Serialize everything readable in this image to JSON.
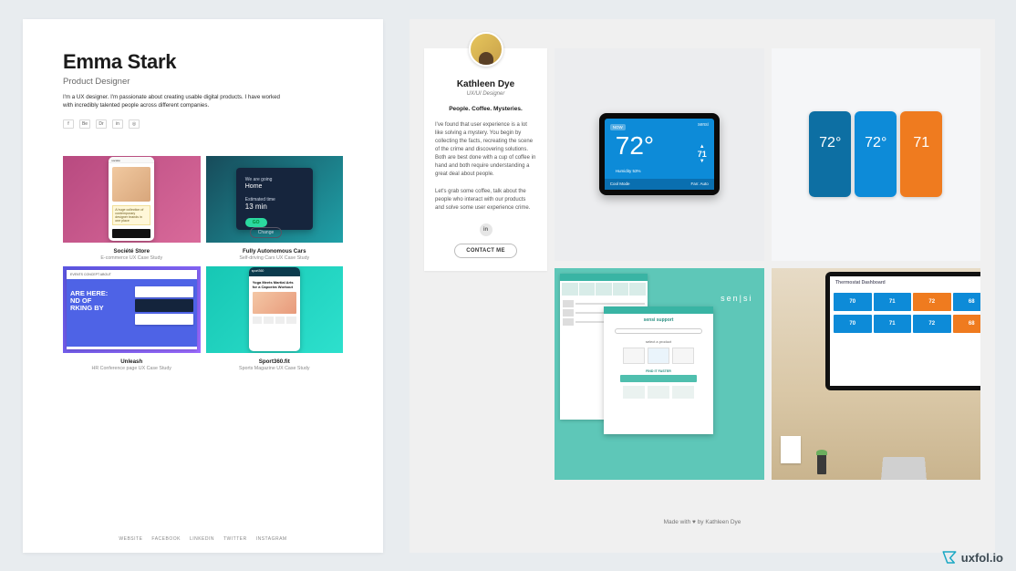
{
  "brand": "uxfol.io",
  "left": {
    "name": "Emma Stark",
    "title": "Product Designer",
    "bio": "I'm a UX designer. I'm passionate about creating usable digital products. I have worked with incredibly talented people across different companies.",
    "social": [
      "f",
      "Be",
      "Dr",
      "in",
      "◎"
    ],
    "projects": [
      {
        "title": "Société Store",
        "sub": "E-commerce UX Case Study"
      },
      {
        "title": "Fully Autonomous Cars",
        "sub": "Self-driving Cars UX Case Study"
      },
      {
        "title": "Unleash",
        "sub": "HR Conference page UX Case Study"
      },
      {
        "title": "Sport360.fit",
        "sub": "Sports Magazine UX Case Study"
      }
    ],
    "thumb1": {
      "brand": "société",
      "caption": "A huge collection of contemporary designer brands in one place"
    },
    "thumb2": {
      "line1_lbl": "We are going",
      "line1_val": "Home",
      "line2_lbl": "Estimated time",
      "line2_val": "13 min",
      "go": "GO",
      "change": "Change"
    },
    "thumb3": {
      "nav": "EVENTS  CONCEPT  ABOUT",
      "head1": "ARE HERE:",
      "head2": "ND OF",
      "head3": "RKING BY"
    },
    "thumb4": {
      "brand": "sport360",
      "headline": "Yoga Meets Martial Arts for a Capoeira Workout"
    },
    "footer": [
      "WEBSITE",
      "FACEBOOK",
      "LINKEDIN",
      "TWITTER",
      "INSTAGRAM"
    ]
  },
  "right": {
    "name": "Kathleen Dye",
    "title": "UX/UI Designer",
    "tagline": "People. Coffee. Mysteries.",
    "para1": "I've found that user experience is a lot like solving a mystery. You begin by collecting the facts, recreating the scene of the crime and discovering solutions. Both are best done with a cup of coffee in hand and both require understanding a great deal about people.",
    "para2": "Let's grab some coffee, talk about the people who interact with our products and solve some user experience crime.",
    "linkedin": "in",
    "contact": "CONTACT ME",
    "footer": "Made with ♥ by Kathleen Dye",
    "gtile1": {
      "brand": "sensi",
      "temp": "72°",
      "now": "NOW",
      "target": "71",
      "hum": "Humidity  53%",
      "cool": "Cool Mode",
      "fan": "Fan: Auto"
    },
    "gtile2": {
      "t1": "72°",
      "t2": "72°",
      "t3": "71"
    },
    "gtile3": {
      "brand": "sen|si",
      "label1": "sensi support",
      "label2": "select a product",
      "label3": "FIND IT FASTER"
    },
    "gtile4": {
      "title": "Thermostat Dashboard",
      "vals": [
        "70",
        "71",
        "72",
        "68",
        "70",
        "71",
        "72",
        "68"
      ]
    }
  }
}
